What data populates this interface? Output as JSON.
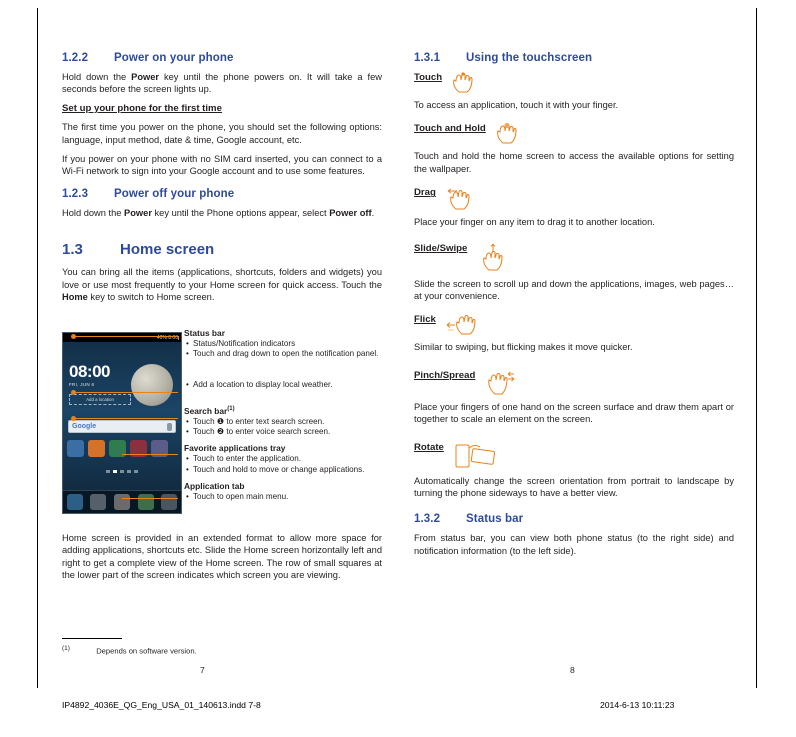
{
  "left": {
    "s122": {
      "num": "1.2.2",
      "title": "Power on your phone",
      "p1_a": "Hold down the ",
      "p1_b": "Power",
      "p1_c": " key until the phone powers on. It will take a few seconds before the screen lights up.",
      "sub1": "Set up your phone for the first time",
      "p2": "The first time you power on the phone, you should set the following options: language, input method, date & time, Google account, etc.",
      "p3": "If you power on your phone with no SIM card inserted, you can connect to a Wi-Fi network to sign into your Google account and to use some features."
    },
    "s123": {
      "num": "1.2.3",
      "title": "Power off your phone",
      "p1_a": "Hold down the ",
      "p1_b": "Power",
      "p1_c": " key until the Phone options appear, select ",
      "p1_d": "Power off",
      "p1_e": "."
    },
    "s13": {
      "num": "1.3",
      "title": "Home screen",
      "p1_a": "You can bring all the items (applications, shortcuts, folders and widgets) you love or use most frequently to your Home screen for quick access. Touch the ",
      "p1_b": "Home",
      "p1_c": " key to switch to Home screen."
    },
    "phone": {
      "status_left": "",
      "status_right": "40%  8:00",
      "clock": "08:00",
      "clock_sub": "FRI, JUN 6",
      "add_location": "Add a location",
      "search_placeholder": "Google"
    },
    "callouts": [
      {
        "title": "Status bar",
        "items": [
          "Status/Notification indicators",
          "Touch and drag down to open the notification panel."
        ]
      },
      {
        "title": "",
        "items": [
          "Add a location to display local weather."
        ]
      },
      {
        "title": "Search bar",
        "sup": "(1)",
        "items": [
          "Touch ❶ to enter text search screen.",
          "Touch ❷ to enter voice search screen."
        ]
      },
      {
        "title": "Favorite applications tray",
        "items": [
          "Touch to enter the application.",
          "Touch and hold to move or change applications."
        ]
      },
      {
        "title": "Application tab",
        "items": [
          "Touch to open main menu."
        ]
      }
    ],
    "closing": "Home screen is provided in an extended format to allow more space for adding applications, shortcuts etc. Slide the Home screen horizontally left and right to get a complete view of the Home screen. The row of small squares at the lower part of the screen indicates which screen you are viewing.",
    "footnote_mark": "(1)",
    "footnote_text": "Depends on software version.",
    "page_number": "7"
  },
  "right": {
    "s131": {
      "num": "1.3.1",
      "title": "Using the touchscreen",
      "blocks": [
        {
          "head": "Touch",
          "text": "To access an application, touch it with your finger."
        },
        {
          "head": "Touch and Hold",
          "text": "Touch and hold the home screen to access the available options for setting the wallpaper."
        },
        {
          "head": "Drag",
          "text": "Place your finger on any item to drag it to another location."
        },
        {
          "head": "Slide/Swipe",
          "text": "Slide the screen to scroll up and down the applications, images, web pages… at your convenience."
        },
        {
          "head": "Flick",
          "text": "Similar to swiping, but flicking makes it move quicker."
        },
        {
          "head": "Pinch/Spread",
          "text": "Place your fingers of one hand on the screen surface and draw them apart or together to scale an element on the screen."
        },
        {
          "head": "Rotate",
          "text": "Automatically change the screen orientation from portrait to landscape by turning the phone sideways to have a better view."
        }
      ]
    },
    "s132": {
      "num": "1.3.2",
      "title": "Status bar",
      "p1": "From status bar, you can view both phone status (to the right side) and notification information (to the left side)."
    },
    "page_number": "8"
  },
  "bottom": {
    "file": "IP4892_4036E_QG_Eng_USA_01_140613.indd   7-8",
    "timestamp": "2014-6-13   10:11:23"
  },
  "colors": {
    "heading": "#2e4a9e",
    "accent": "#e8821a",
    "text": "#231f20"
  }
}
